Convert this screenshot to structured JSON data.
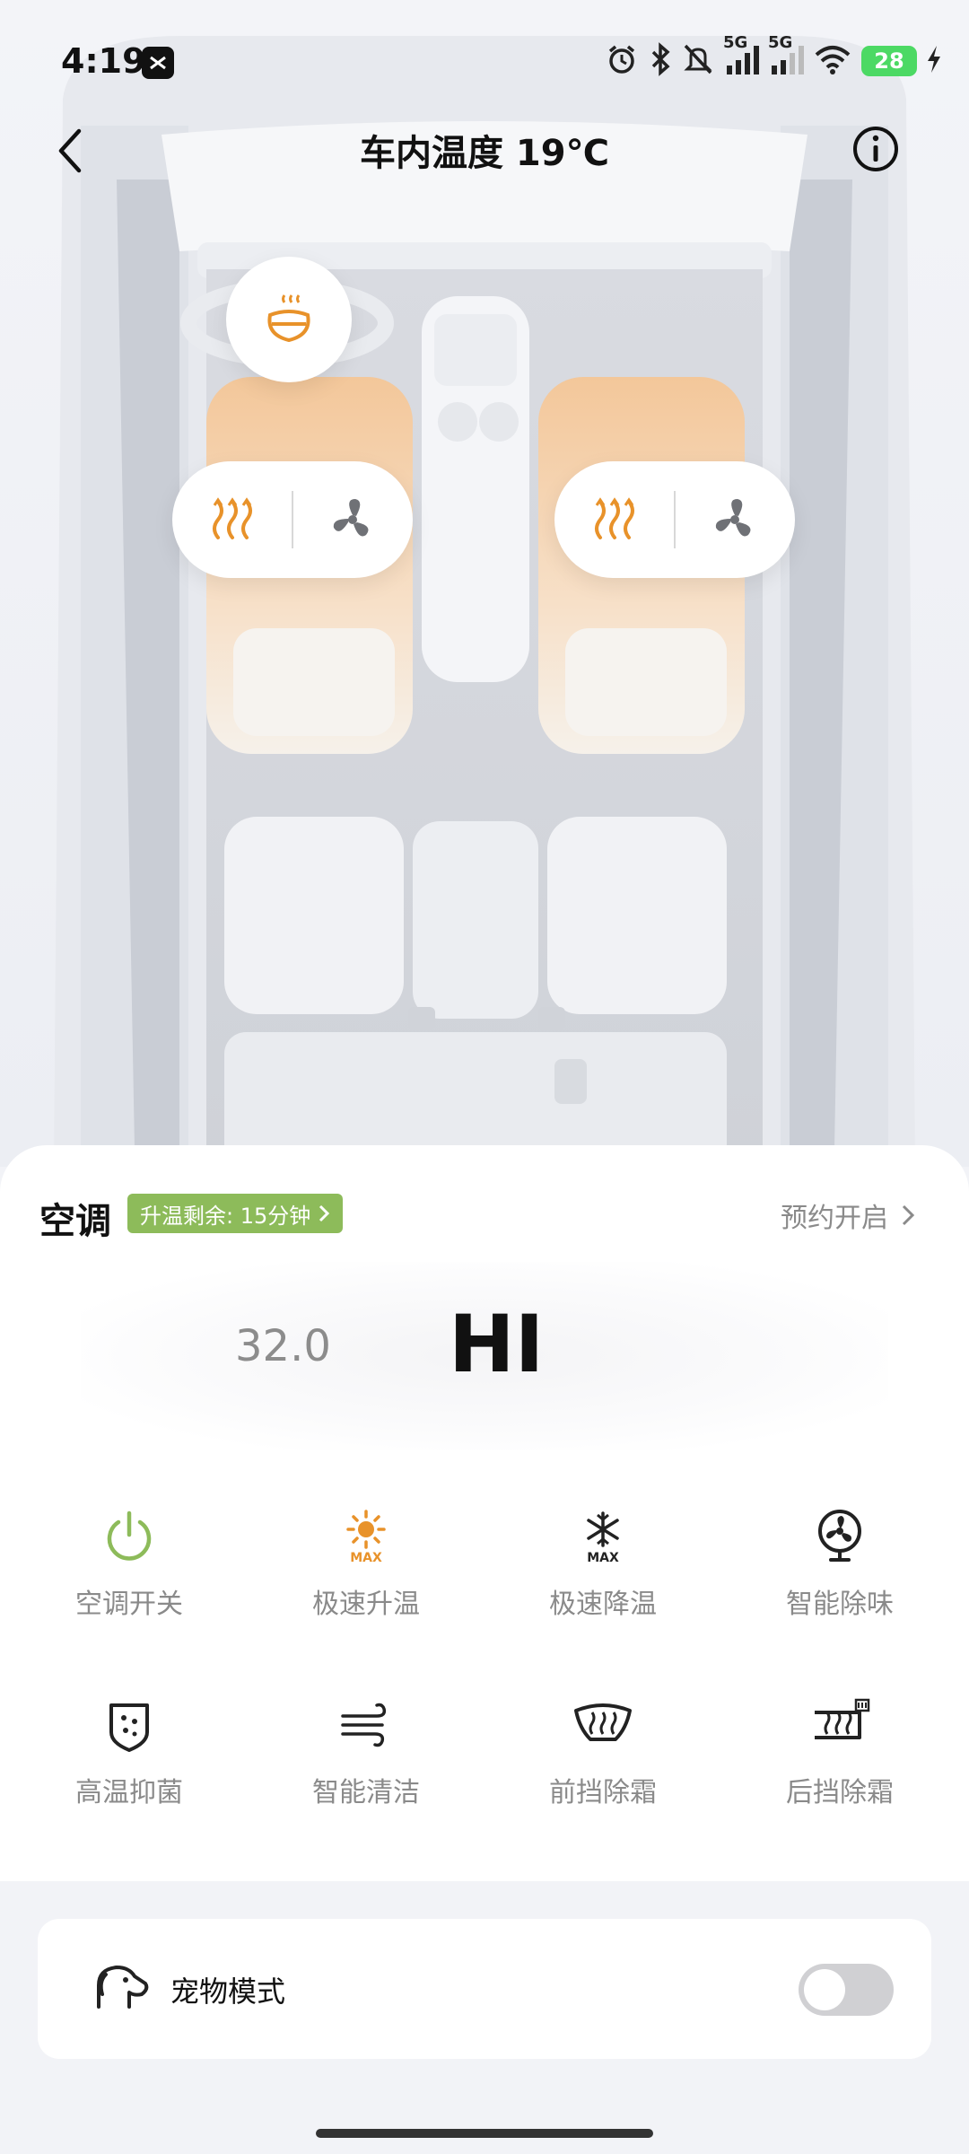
{
  "status_bar": {
    "time": "4:19",
    "network_1": "5G",
    "network_2": "5G",
    "battery": "28",
    "icons": [
      "alarm-icon",
      "bluetooth-icon",
      "mute-icon",
      "signal-icon",
      "wifi-icon",
      "battery-icon",
      "charging-icon"
    ]
  },
  "header": {
    "title": "车内温度 19℃"
  },
  "seats": {
    "steering_heat_active": true,
    "left_heat_active": true,
    "right_heat_active": true,
    "accent_color": "#e8922a"
  },
  "climate": {
    "title": "空调",
    "timer_badge": "升温剩余: 15分钟",
    "schedule_label": "预约开启",
    "temp_left": "32.0",
    "temp_main": "HI",
    "power_color": "#8dbb5a"
  },
  "functions": [
    {
      "label": "空调开关",
      "icon": "power-icon"
    },
    {
      "label": "极速升温",
      "icon": "sun-max-icon"
    },
    {
      "label": "极速降温",
      "icon": "snowflake-max-icon"
    },
    {
      "label": "智能除味",
      "icon": "fan-icon"
    },
    {
      "label": "高温抑菌",
      "icon": "shield-dots-icon"
    },
    {
      "label": "智能清洁",
      "icon": "wind-icon"
    },
    {
      "label": "前挡除霜",
      "icon": "front-defrost-icon"
    },
    {
      "label": "后挡除霜",
      "icon": "rear-defrost-icon"
    }
  ],
  "pet_mode": {
    "label": "宠物模式",
    "enabled": false
  }
}
